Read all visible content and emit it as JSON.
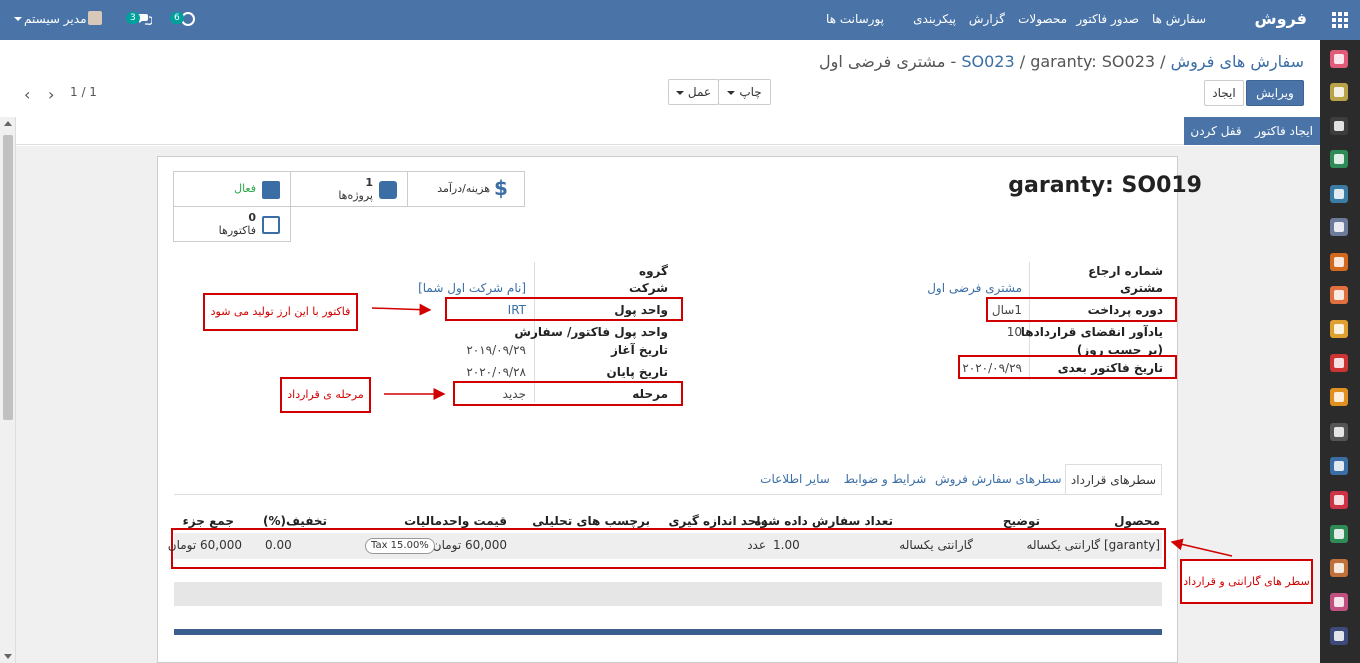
{
  "navbar": {
    "brand": "فروش",
    "menu": [
      "سفارش ها",
      "صدور فاکتور",
      "محصولات",
      "گزارش",
      "پیکربندی",
      "پورسانت ها"
    ],
    "user": "مدیر سیستم",
    "messages_count": "3",
    "activities_count": "6"
  },
  "breadcrumb": {
    "root": "سفارش های فروش",
    "sep": "/",
    "order": "SO023",
    "current": "garanty: SO023 - مشتری فرضی اول"
  },
  "toolbar": {
    "edit": "ویرایش",
    "create": "ایجاد",
    "print": "چاپ",
    "action": "عمل",
    "pager": "1 / 1"
  },
  "status": {
    "create_invoice": "ایجاد فاکتور",
    "lock": "قفل کردن"
  },
  "smart_buttons": {
    "cost": "هزینه/درآمد",
    "projects_count": "1",
    "projects": "پروژه‌ها",
    "active": "فعال",
    "invoices_count": "0",
    "invoices": "فاکتورها"
  },
  "record": {
    "title": "garanty: SO019"
  },
  "fields_right": {
    "ref_label": "شماره ارجاع",
    "customer_label": "مشتری",
    "customer_value": "مشتری فرضی اول",
    "period_label": "دوره پرداخت",
    "period_value": "1سال",
    "reminder_label": "یادآور انقضای قراردادها",
    "reminder_label2": "(بر حسب روز)",
    "reminder_value": "10",
    "next_invoice_label": "تاریخ فاکتور بعدی",
    "next_invoice_value": "۲۰۲۰/۰۹/۲۹"
  },
  "fields_left": {
    "group_label": "گروه",
    "company_label": "شرکت",
    "company_value": "[نام شرکت اول شما]",
    "currency_label": "واحد پول",
    "currency_value": "IRT",
    "invoice_currency_label": "واحد پول فاکتور/ سفارش",
    "start_label": "تاریخ آغاز",
    "start_value": "۲۰۱۹/۰۹/۲۹",
    "end_label": "تاریخ پایان",
    "end_value": "۲۰۲۰/۰۹/۲۸",
    "stage_label": "مرحله",
    "stage_value": "جدید"
  },
  "annotations": {
    "invoice_currency": "فاکتور با این ارز تولید می شود",
    "contract_stage": "مرحله ی قرارداد",
    "lines": "سطر های گارانتی و قرارداد"
  },
  "tabs": [
    "سطرهای قرارداد",
    "سطرهای سفارش فروش",
    "شرایط و ضوابط",
    "سایر اطلاعات"
  ],
  "table": {
    "headers": [
      "محصول",
      "توضیح",
      "تعداد سفارش داده شده",
      "واحد اندازه گیری",
      "برچسب های تحلیلی",
      "قیمت واحد",
      "مالیات",
      "تخفیف(%)",
      "جمع جزء"
    ],
    "row": {
      "product": "[garanty] گارانتی یکساله",
      "description": "گارانتی یکساله",
      "qty": "1.00",
      "uom": "عدد",
      "analytic": "",
      "price": "60,000 تومان",
      "tax": "Tax 15.00%",
      "discount": "0.00",
      "subtotal": "60,000 تومان"
    }
  },
  "colors": {
    "brand": "#4a74a8",
    "annotation": "#d10000",
    "active_green": "#28a745"
  }
}
